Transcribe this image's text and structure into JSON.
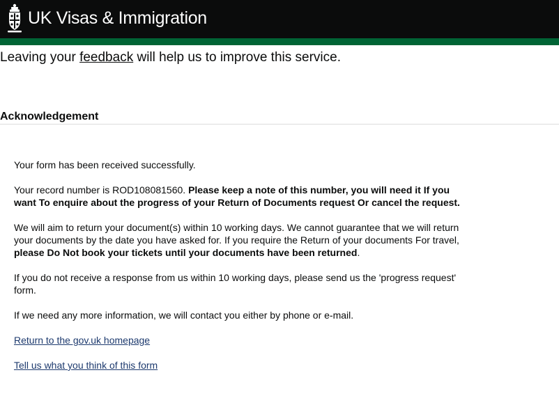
{
  "header": {
    "brand_name": "UK Visas & Immigration",
    "crest_icon": "royal-crest-icon",
    "background_color": "#0b0c0c",
    "stripe_color": "#006435"
  },
  "feedback_banner": {
    "prefix": "Leaving your ",
    "link_text": "feedback",
    "suffix": " will help us to improve this service."
  },
  "acknowledgement": {
    "title": "Acknowledgement",
    "received": "Your form has been received successfully.",
    "record_prefix": "Your record number is ",
    "record_number": "ROD108081560.",
    "record_bold": " Please keep a note of this number, you will need it If you want To enquire about the progress of your Return of Documents request Or cancel the request.",
    "return_text": "We will aim to return your document(s) within 10 working days. We cannot guarantee that we will return your documents by the date you have asked for. If you require the Return of your documents For travel, ",
    "return_bold": "please Do Not book your tickets until your documents have been returned",
    "return_end": ".",
    "no_response": "If you do not receive a response from us within 10 working days, please send us the 'progress request' form.",
    "more_info": "If we need any more information, we will contact you either by phone or e-mail.",
    "home_link": "Return to the gov.uk homepage",
    "feedback_link": "Tell us what you think of this form"
  }
}
